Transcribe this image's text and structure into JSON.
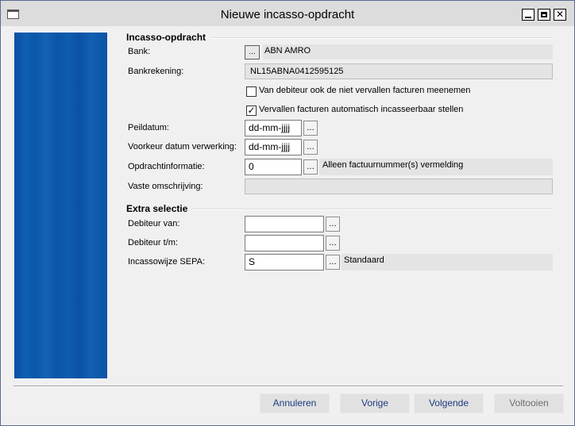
{
  "window": {
    "title": "Nieuwe incasso-opdracht"
  },
  "section1": {
    "title": "Incasso-opdracht",
    "bank_label": "Bank:",
    "bank_btn": "...",
    "bank_value": "ABN AMRO",
    "rekening_label": "Bankrekening:",
    "rekening_value": "NL15ABNA0412595125",
    "chk1": {
      "label": "Van debiteur ook de niet vervallen facturen meenemen",
      "checked": false
    },
    "chk2": {
      "label": "Vervallen facturen automatisch incasseerbaar stellen",
      "checked": true,
      "mark": "✓"
    },
    "peildatum_label": "Peildatum:",
    "peildatum_value": "dd-mm-jjjj",
    "voorkeur_label": "Voorkeur datum verwerking:",
    "voorkeur_value": "dd-mm-jjjj",
    "opdracht_label": "Opdrachtinformatie:",
    "opdracht_value": "0",
    "opdracht_desc": "Alleen factuurnummer(s) vermelding",
    "vaste_label": "Vaste omschrijving:",
    "vaste_value": ""
  },
  "section2": {
    "title": "Extra selectie",
    "deb_van_label": "Debiteur van:",
    "deb_van_value": "",
    "deb_tm_label": "Debiteur t/m:",
    "deb_tm_value": "",
    "sepa_label": "Incassowijze SEPA:",
    "sepa_value": "S",
    "sepa_desc": "Standaard"
  },
  "dots": "...",
  "buttons": {
    "annuleren": "Annuleren",
    "vorige": "Vorige",
    "volgende": "Volgende",
    "voltooien": "Voltooien"
  },
  "icons": {
    "minimize": "minimize-icon",
    "maximize": "maximize-icon",
    "close": "close-icon",
    "close_glyph": "✕"
  },
  "colors": {
    "banner": "#0b56a8",
    "link_text": "#1c3d82"
  }
}
